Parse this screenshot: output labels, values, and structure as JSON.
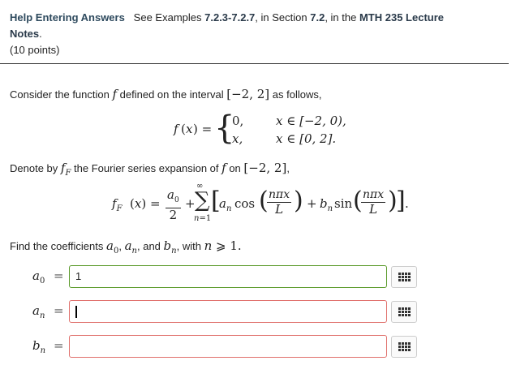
{
  "header": {
    "help_link": "Help Entering Answers",
    "see_text": "See Examples",
    "examples_range": "7.2.3-7.2.7",
    "in_section": ", in Section",
    "section_num": "7.2",
    "in_the": ", in the",
    "notes_title_1": "MTH 235 Lecture",
    "notes_title_2": "Notes",
    "points": "(10 points)"
  },
  "problem": {
    "intro_pre": "Consider the function",
    "intro_mid": "defined on the interval",
    "intro_post": "as follows,",
    "interval": "[−2, 2]",
    "func_name": "f",
    "piece1_value": "0,",
    "piece1_cond": "x ∈ [−2, 0),",
    "piece2_value": "x,",
    "piece2_cond": "x ∈ [0, 2].",
    "denote_pre": "Denote by",
    "denote_mid": "the Fourier series expansion of",
    "denote_on": "on",
    "find_text": "Find the coefficients",
    "with_text": "with"
  },
  "answers": [
    {
      "label": "a",
      "sub": "0",
      "value": "1",
      "status": "correct"
    },
    {
      "label": "a",
      "sub": "n",
      "value": "",
      "status": "incorrect"
    },
    {
      "label": "b",
      "sub": "n",
      "value": "",
      "status": "incorrect"
    }
  ],
  "icons": {
    "matrix_button": "matrix-grid-icon"
  },
  "colors": {
    "correct_border": "#5a9a2a",
    "incorrect_border": "#e0706c",
    "header_text": "#2e4a5e"
  }
}
